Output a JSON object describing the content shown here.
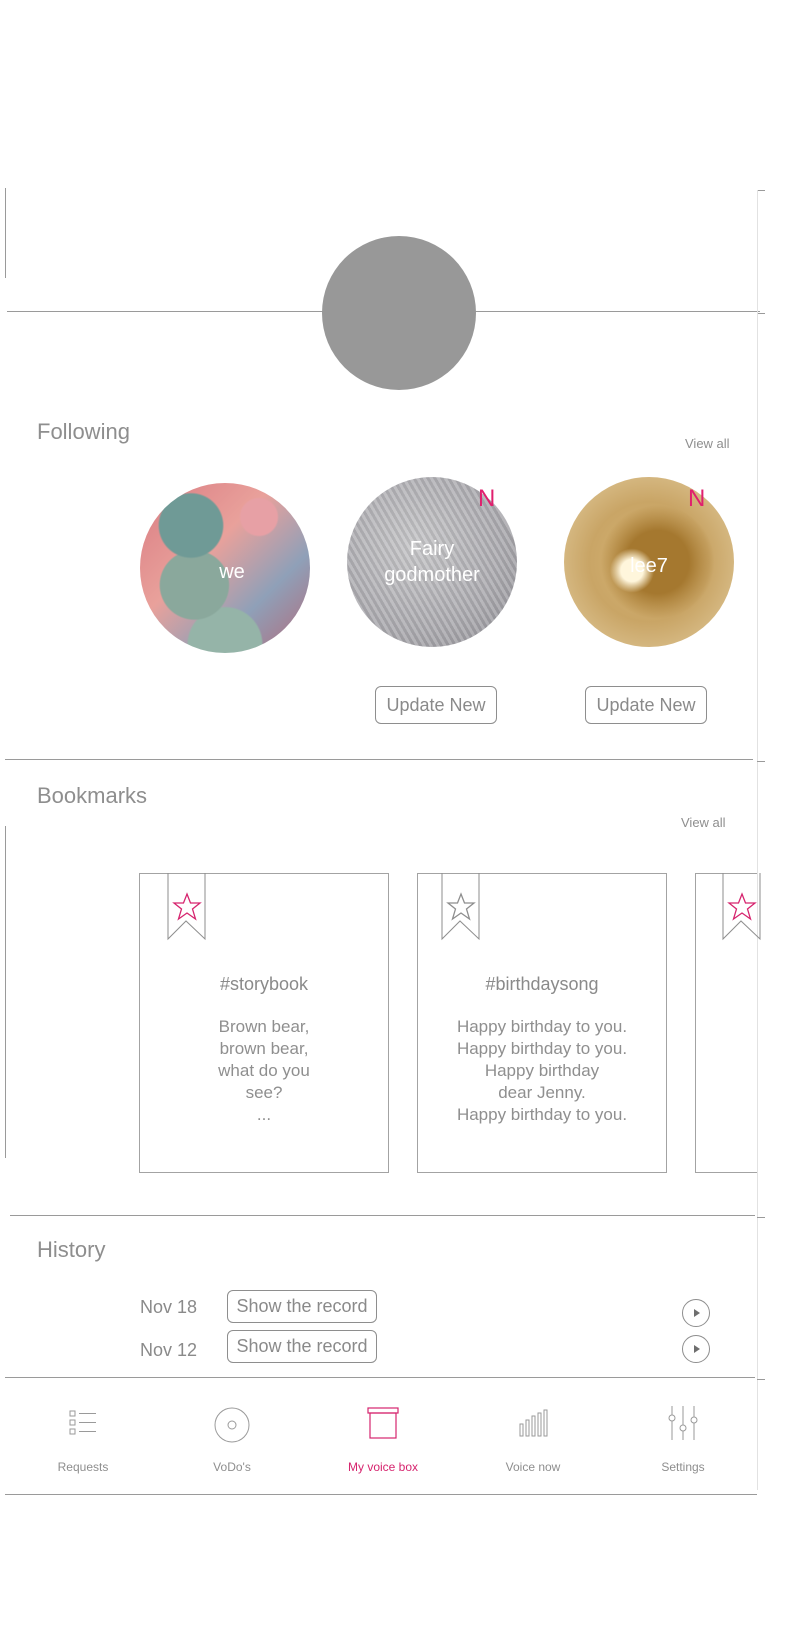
{
  "colors": {
    "accent": "#d6246e",
    "line": "#9a9a9a",
    "text": "#8e8e8e",
    "avatar": "#989898"
  },
  "following": {
    "title": "Following",
    "view_all": "View all",
    "items": [
      {
        "name": "we",
        "new_badge": ""
      },
      {
        "name": "Fairy godmother",
        "new_badge": "N"
      },
      {
        "name": "lee7",
        "new_badge": "N"
      }
    ],
    "update_buttons": [
      "Update New",
      "Update New"
    ]
  },
  "bookmarks": {
    "title": "Bookmarks",
    "view_all": "View all",
    "cards": [
      {
        "tag": "#storybook",
        "text": "Brown bear,\nbrown bear,\nwhat do you\nsee?\n...",
        "star_icon": "star-outline-icon",
        "star_color": "#d6246e"
      },
      {
        "tag": "#birthdaysong",
        "text": "Happy birthday to you.\nHappy birthday to you.\nHappy birthday\ndear Jenny.\nHappy birthday to you.",
        "star_icon": "star-outline-icon",
        "star_color": "#8e8e8e"
      }
    ]
  },
  "history": {
    "title": "History",
    "items": [
      {
        "date": "Nov 18",
        "button": "Show the record"
      },
      {
        "date": "Nov 12",
        "button": "Show the record"
      }
    ]
  },
  "tabbar": {
    "tabs": [
      {
        "label": "Requests",
        "icon": "list-icon"
      },
      {
        "label": "VoDo's",
        "icon": "disc-icon"
      },
      {
        "label": "My voice box",
        "icon": "box-icon",
        "active": true
      },
      {
        "label": "Voice now",
        "icon": "bars-icon"
      },
      {
        "label": "Settings",
        "icon": "sliders-icon"
      }
    ]
  }
}
